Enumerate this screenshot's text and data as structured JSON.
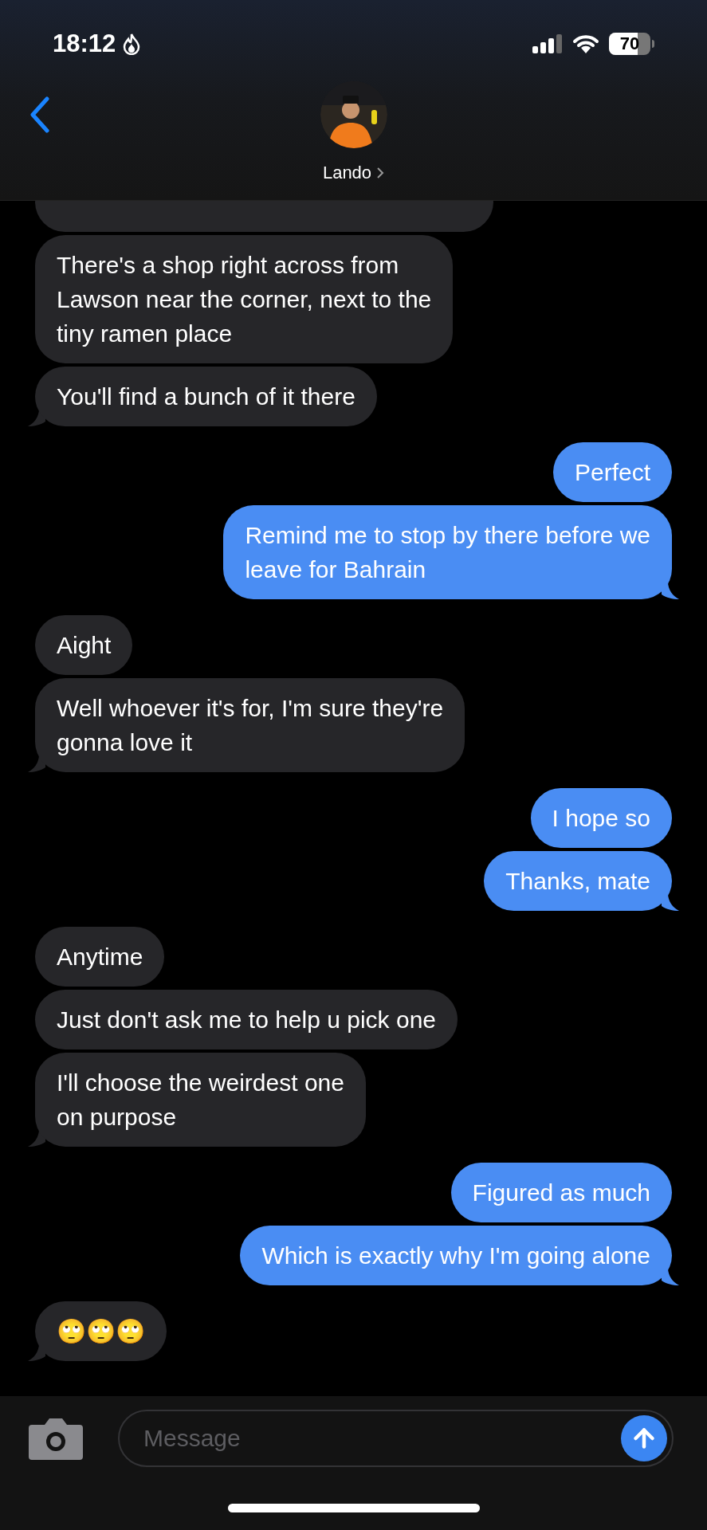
{
  "status_bar": {
    "time": "18:12",
    "battery": "70"
  },
  "header": {
    "contact_name": "Lando"
  },
  "messages": [
    {
      "kind": "them"
    },
    {
      "kind": "them",
      "text": "There's a shop right across from\nLawson near the corner, next to the\ntiny ramen place"
    },
    {
      "kind": "them",
      "text": "You'll find a bunch of it there"
    },
    {
      "kind": "me",
      "text": "Perfect"
    },
    {
      "kind": "me",
      "text": "Remind me to stop by there before we\nleave for Bahrain"
    },
    {
      "kind": "them",
      "text": "Aight"
    },
    {
      "kind": "them",
      "text": "Well whoever it's for, I'm sure they're\ngonna love it"
    },
    {
      "kind": "me",
      "text": "I hope so"
    },
    {
      "kind": "me",
      "text": "Thanks, mate"
    },
    {
      "kind": "them",
      "text": "Anytime"
    },
    {
      "kind": "them",
      "text": "Just don't ask me to help u pick one"
    },
    {
      "kind": "them",
      "text": "I'll choose the weirdest one\non purpose"
    },
    {
      "kind": "me",
      "text": "Figured as much"
    },
    {
      "kind": "me",
      "text": "Which is exactly why I'm going alone"
    },
    {
      "kind": "them",
      "text": "🙄🙄🙄"
    }
  ],
  "composer": {
    "placeholder": "Message"
  }
}
